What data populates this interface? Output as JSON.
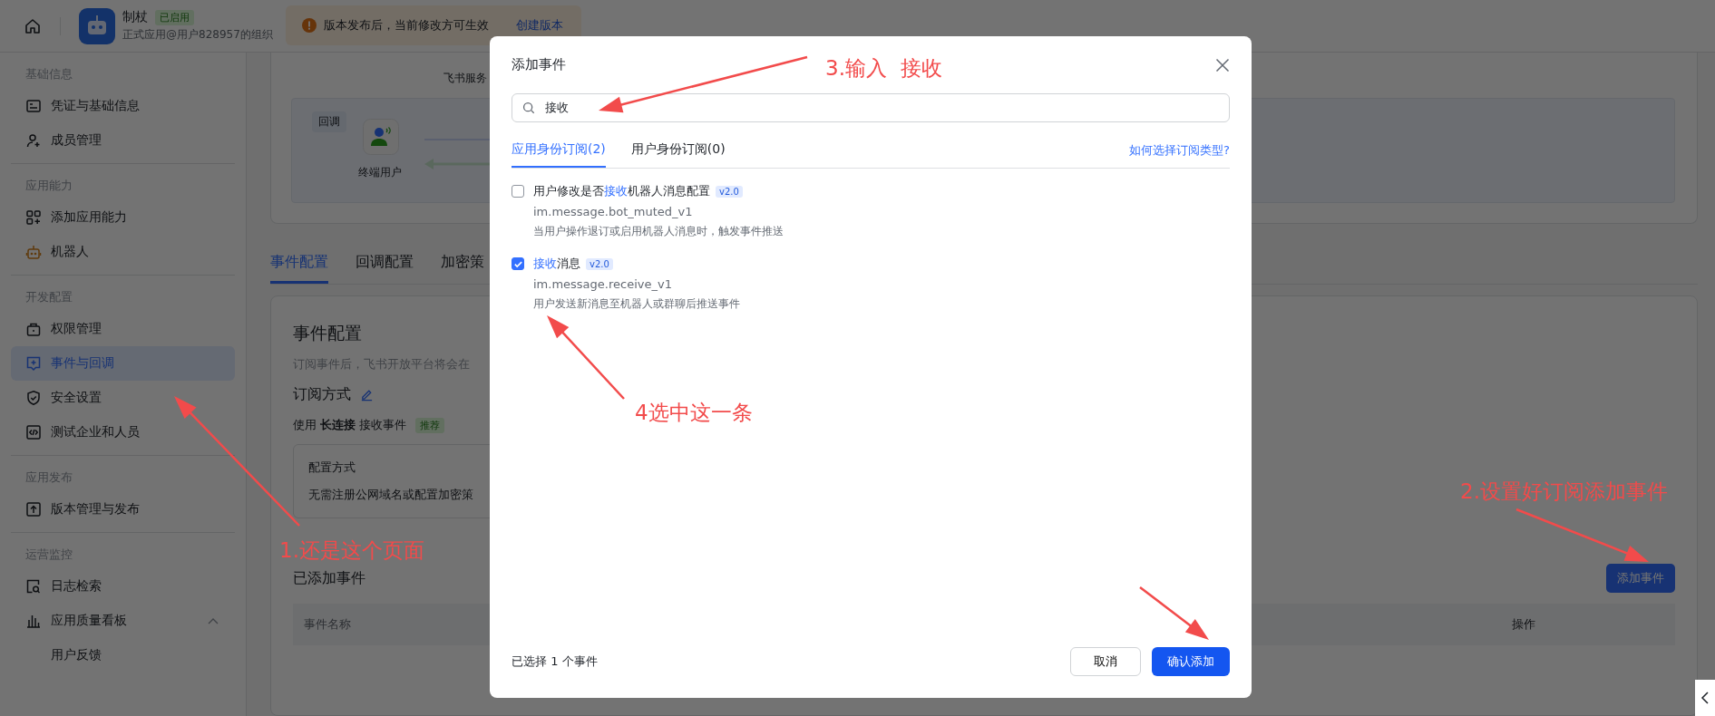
{
  "topbar": {
    "app_name": "制杖",
    "app_status": "已启用",
    "app_org": "正式应用@用户828957的组织",
    "notice": "版本发布后，当前修改方可生效",
    "notice_link": "创建版本"
  },
  "sidebar": {
    "sections": [
      {
        "title": "基础信息",
        "items": [
          {
            "label": "凭证与基础信息",
            "selected": false
          },
          {
            "label": "成员管理",
            "selected": false
          }
        ]
      },
      {
        "title": "应用能力",
        "items": [
          {
            "label": "添加应用能力",
            "selected": false
          },
          {
            "label": "机器人",
            "selected": false
          }
        ]
      },
      {
        "title": "开发配置",
        "items": [
          {
            "label": "权限管理",
            "selected": false
          },
          {
            "label": "事件与回调",
            "selected": true
          },
          {
            "label": "安全设置",
            "selected": false
          },
          {
            "label": "测试企业和人员",
            "selected": false
          }
        ]
      },
      {
        "title": "应用发布",
        "items": [
          {
            "label": "版本管理与发布",
            "selected": false
          }
        ]
      },
      {
        "title": "运营监控",
        "items": [
          {
            "label": "日志检索",
            "selected": false
          },
          {
            "label": "应用质量看板",
            "selected": false,
            "expanded": true,
            "children": [
              {
                "label": "用户反馈",
                "selected": false
              }
            ]
          }
        ]
      }
    ]
  },
  "main": {
    "diagram": {
      "service_label": "飞书服务",
      "callback_tag": "回调",
      "user_label": "终端用户"
    },
    "tabs": [
      {
        "label": "事件配置",
        "selected": true
      },
      {
        "label": "回调配置",
        "selected": false
      },
      {
        "label": "加密策",
        "selected": false
      }
    ],
    "section_title": "事件配置",
    "section_desc": "订阅事件后，飞书开放平台将会在",
    "subscribe_title": "订阅方式",
    "subscribe_text": "使用 **长连接** 接收事件",
    "subscribe_badge": "推荐",
    "config_title": "配置方式",
    "config_desc": "无需注册公网域名或配置加密策",
    "added_title": "已添加事件",
    "add_button": "添加事件",
    "table_columns": [
      "事件名称",
      "操作"
    ]
  },
  "dialog": {
    "title": "添加事件",
    "search": {
      "value": "接收"
    },
    "tabs": [
      {
        "label": "应用身份订阅(2)",
        "selected": true
      },
      {
        "label": "用户身份订阅(0)",
        "selected": false
      }
    ],
    "help_link": "如何选择订阅类型?",
    "events": [
      {
        "checked": false,
        "title": [
          {
            "text": "用户修改是否",
            "match": false
          },
          {
            "text": "接收",
            "match": true
          },
          {
            "text": "机器人消息配置",
            "match": false
          }
        ],
        "version": "v2.0",
        "code": "im.message.bot_muted_v1",
        "desc": "当用户操作退订或启用机器人消息时，触发事件推送"
      },
      {
        "checked": true,
        "title": [
          {
            "text": "接收",
            "match": true
          },
          {
            "text": "消息",
            "match": false
          }
        ],
        "version": "v2.0",
        "code": "im.message.receive_v1",
        "desc": "用户发送新消息至机器人或群聊后推送事件"
      }
    ],
    "selection_summary": "已选择 1 个事件",
    "cancel": "取消",
    "confirm": "确认添加"
  },
  "annotations": [
    {
      "text": "3.输入  接收"
    },
    {
      "text": "4选中这一条"
    },
    {
      "text": "1.还是这个页面"
    },
    {
      "text": "2.设置好订阅添加事件"
    }
  ]
}
